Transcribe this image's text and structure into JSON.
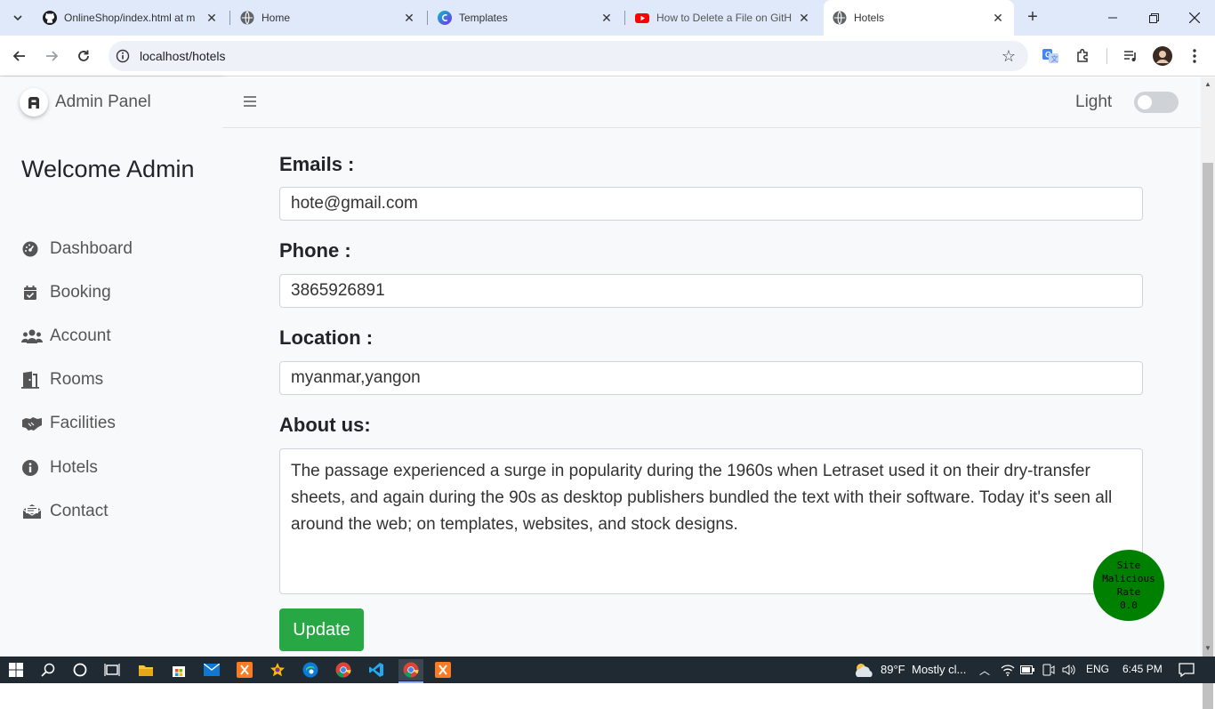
{
  "browser": {
    "tabs": [
      {
        "title": "OnlineShop/index.html at m",
        "icon": "github-icon"
      },
      {
        "title": "Home",
        "icon": "globe-icon"
      },
      {
        "title": "Templates",
        "icon": "canva-icon"
      },
      {
        "title": "How to Delete a File on GitH",
        "icon": "youtube-icon"
      },
      {
        "title": "Hotels",
        "icon": "globe-icon",
        "active": true
      }
    ],
    "url": "localhost/hotels"
  },
  "sidebar": {
    "brand": "Admin Panel",
    "welcome": "Welcome Admin",
    "items": [
      {
        "label": "Dashboard",
        "icon": "dashboard-icon"
      },
      {
        "label": "Booking",
        "icon": "calendar-check-icon"
      },
      {
        "label": "Account",
        "icon": "users-icon"
      },
      {
        "label": "Rooms",
        "icon": "door-icon"
      },
      {
        "label": "Facilities",
        "icon": "handshake-icon"
      },
      {
        "label": "Hotels",
        "icon": "info-circle-icon"
      },
      {
        "label": "Contact",
        "icon": "envelope-open-icon"
      }
    ]
  },
  "header": {
    "theme_label": "Light",
    "theme_toggle_on": false
  },
  "form": {
    "emails_label": "Emails :",
    "emails_value": "hote@gmail.com",
    "phone_label": "Phone :",
    "phone_value": "3865926891",
    "location_label": "Location :",
    "location_value": "myanmar,yangon",
    "about_label": "About us:",
    "about_value": "The passage experienced a surge in popularity during the 1960s when Letraset used it on their dry-transfer sheets, and again during the 90s as desktop publishers bundled the text with their software. Today it's seen all around the web; on templates, websites, and stock designs.",
    "update_label": "Update"
  },
  "badge": {
    "line1": "Site",
    "line2": "Malicious",
    "line3": "Rate",
    "line4": "0.0"
  },
  "taskbar": {
    "weather_temp": "89°F",
    "weather_text": "Mostly cl...",
    "lang": "ENG",
    "time": "6:45 PM"
  },
  "colors": {
    "accent": "#28a745",
    "tabbar": "#dfe9fa",
    "badge": "#008000"
  }
}
